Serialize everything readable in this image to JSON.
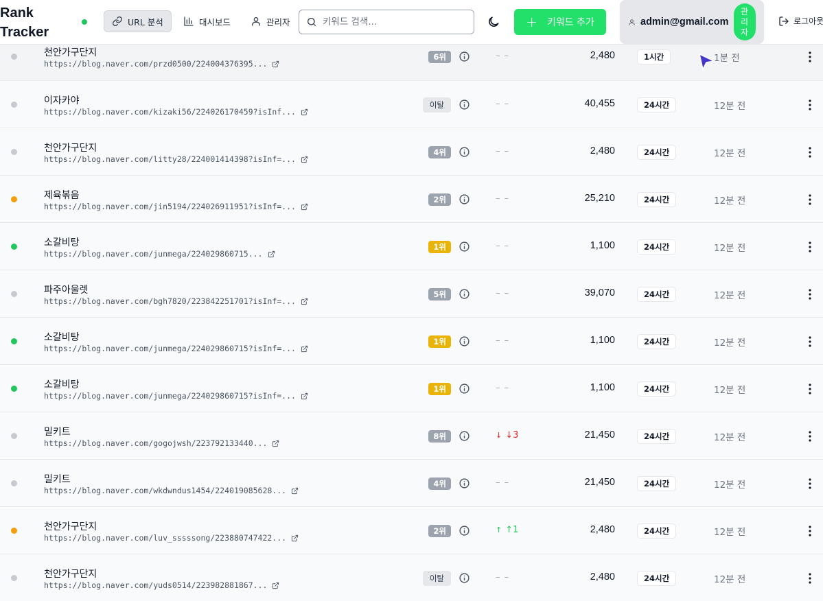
{
  "app": {
    "title": "Rank Tracker"
  },
  "nav": [
    {
      "label": "URL 분석",
      "active": true
    },
    {
      "label": "대시보드",
      "active": false
    },
    {
      "label": "관리자",
      "active": false
    }
  ],
  "search": {
    "placeholder": "키워드 검색..."
  },
  "add_button": {
    "label": "키워드 추가"
  },
  "user": {
    "email": "admin@gmail.com",
    "role_chars": [
      "관",
      "리",
      "자"
    ]
  },
  "logout": {
    "label": "로그아웃"
  },
  "colors": {
    "accent": "#22e06a",
    "status_gray": "#c7cbd1",
    "status_orange": "#f59e0b",
    "status_green": "#22c55e",
    "rank_gray": "#9ca3af",
    "rank_gold": "#eab308",
    "down": "#dc2626",
    "up": "#22c55e"
  },
  "rows": [
    {
      "status": "gray",
      "keyword": "천안가구단지",
      "url": "https://blog.naver.com/przd0500/224004376395...",
      "rank": "6위",
      "rank_style": "gray",
      "change": "– –",
      "change_dir": "none",
      "volume": "2,480",
      "interval": "1시간",
      "updated": "1분 전"
    },
    {
      "status": "gray",
      "keyword": "이자카야",
      "url": "https://blog.naver.com/kizaki56/224026170459?isInf...",
      "rank": "이탈",
      "rank_style": "out",
      "change": "– –",
      "change_dir": "none",
      "volume": "40,455",
      "interval": "24시간",
      "updated": "12분 전"
    },
    {
      "status": "gray",
      "keyword": "천안가구단지",
      "url": "https://blog.naver.com/litty28/224001414398?isInf=...",
      "rank": "4위",
      "rank_style": "gray",
      "change": "– –",
      "change_dir": "none",
      "volume": "2,480",
      "interval": "24시간",
      "updated": "12분 전"
    },
    {
      "status": "orange",
      "keyword": "제육볶음",
      "url": "https://blog.naver.com/jin5194/224026911951?isInf=...",
      "rank": "2위",
      "rank_style": "gray",
      "change": "– –",
      "change_dir": "none",
      "volume": "25,210",
      "interval": "24시간",
      "updated": "12분 전"
    },
    {
      "status": "green",
      "keyword": "소갈비탕",
      "url": "https://blog.naver.com/junmega/224029860715...",
      "rank": "1위",
      "rank_style": "gold",
      "change": "– –",
      "change_dir": "none",
      "volume": "1,100",
      "interval": "24시간",
      "updated": "12분 전"
    },
    {
      "status": "gray",
      "keyword": "파주아울렛",
      "url": "https://blog.naver.com/bgh7820/223842251701?isInf=...",
      "rank": "5위",
      "rank_style": "gray",
      "change": "– –",
      "change_dir": "none",
      "volume": "39,070",
      "interval": "24시간",
      "updated": "12분 전"
    },
    {
      "status": "green",
      "keyword": "소갈비탕",
      "url": "https://blog.naver.com/junmega/224029860715?isInf=...",
      "rank": "1위",
      "rank_style": "gold",
      "change": "– –",
      "change_dir": "none",
      "volume": "1,100",
      "interval": "24시간",
      "updated": "12분 전"
    },
    {
      "status": "green",
      "keyword": "소갈비탕",
      "url": "https://blog.naver.com/junmega/224029860715?isInf=...",
      "rank": "1위",
      "rank_style": "gold",
      "change": "– –",
      "change_dir": "none",
      "volume": "1,100",
      "interval": "24시간",
      "updated": "12분 전"
    },
    {
      "status": "gray",
      "keyword": "밀키트",
      "url": "https://blog.naver.com/gogojwsh/223792133440...",
      "rank": "8위",
      "rank_style": "gray",
      "change": "↓3",
      "change_dir": "down",
      "volume": "21,450",
      "interval": "24시간",
      "updated": "12분 전"
    },
    {
      "status": "gray",
      "keyword": "밀키트",
      "url": "https://blog.naver.com/wkdwndus1454/224019085628...",
      "rank": "4위",
      "rank_style": "gray",
      "change": "– –",
      "change_dir": "none",
      "volume": "21,450",
      "interval": "24시간",
      "updated": "12분 전"
    },
    {
      "status": "orange",
      "keyword": "천안가구단지",
      "url": "https://blog.naver.com/luv_sssssong/223880747422...",
      "rank": "2위",
      "rank_style": "gray",
      "change": "↑1",
      "change_dir": "up",
      "volume": "2,480",
      "interval": "24시간",
      "updated": "12분 전"
    },
    {
      "status": "gray",
      "keyword": "천안가구단지",
      "url": "https://blog.naver.com/yuds0514/223982881867...",
      "rank": "이탈",
      "rank_style": "out",
      "change": "– –",
      "change_dir": "none",
      "volume": "2,480",
      "interval": "24시간",
      "updated": "12분 전"
    }
  ]
}
